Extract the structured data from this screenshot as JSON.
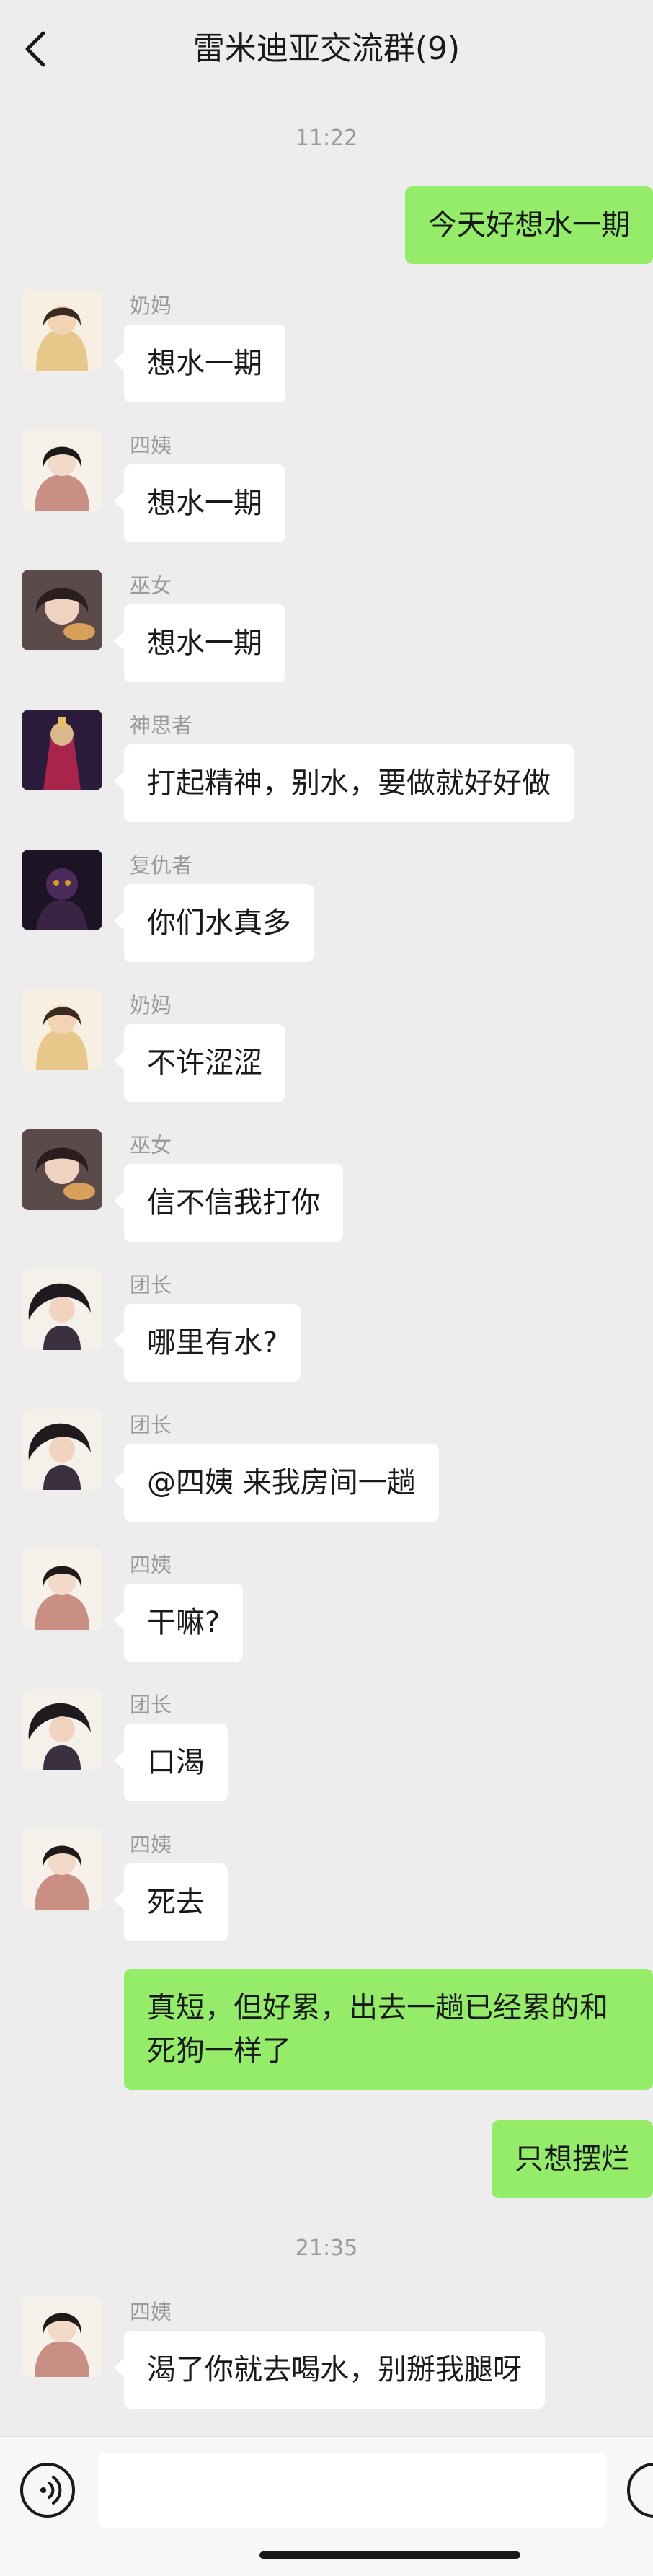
{
  "header": {
    "title": "雷米迪亚交流群(9)"
  },
  "timestamps": [
    "11:22",
    "21:35"
  ],
  "messages": [
    {
      "from": "me",
      "text": "今天好想水一期"
    },
    {
      "from": "other",
      "sender": "奶妈",
      "text": "想水一期"
    },
    {
      "from": "other",
      "sender": "四姨",
      "text": "想水一期"
    },
    {
      "from": "other",
      "sender": "巫女",
      "text": "想水一期"
    },
    {
      "from": "other",
      "sender": "神思者",
      "text": "打起精神，别水，要做就好好做"
    },
    {
      "from": "other",
      "sender": "复仇者",
      "text": "你们水真多"
    },
    {
      "from": "other",
      "sender": "奶妈",
      "text": "不许涩涩"
    },
    {
      "from": "other",
      "sender": "巫女",
      "text": "信不信我打你"
    },
    {
      "from": "other",
      "sender": "团长",
      "text": "哪里有水?"
    },
    {
      "from": "other",
      "sender": "团长",
      "text": "@四姨 来我房间一趟"
    },
    {
      "from": "other",
      "sender": "四姨",
      "text": "干嘛?"
    },
    {
      "from": "other",
      "sender": "团长",
      "text": "口渴"
    },
    {
      "from": "other",
      "sender": "四姨",
      "text": "死去"
    },
    {
      "from": "me",
      "text": "真短，但好累，出去一趟已经累的和死狗一样了"
    },
    {
      "from": "me",
      "text": "只想摆烂"
    },
    {
      "from": "other",
      "sender": "四姨",
      "text": "渴了你就去喝水，别掰我腿呀"
    }
  ],
  "icons": {
    "back": "chevron-left-icon",
    "voice": "voice-icon",
    "emoji": "emoji-icon"
  },
  "colors": {
    "background": "#ededed",
    "my_bubble": "#95ec69",
    "other_bubble": "#ffffff",
    "meta_text": "#9a9a9a"
  }
}
